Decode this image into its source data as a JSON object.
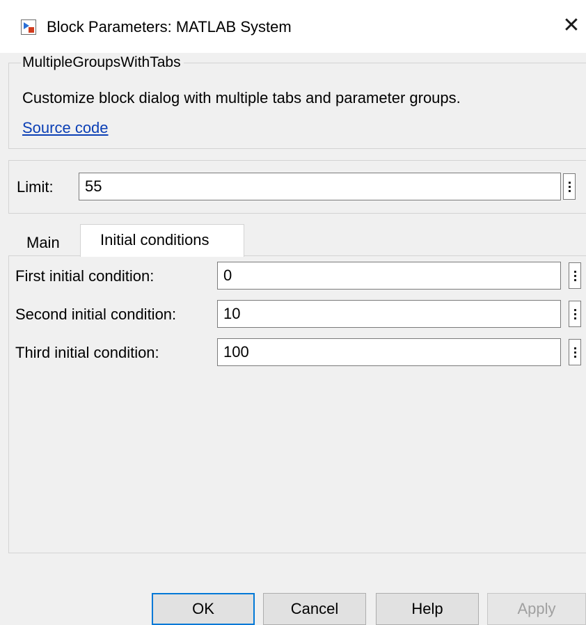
{
  "window": {
    "title": "Block Parameters: MATLAB System",
    "icon": "simulink-block-icon",
    "close_icon": "close-icon"
  },
  "description": {
    "group_title": "MultipleGroupsWithTabs",
    "text": "Customize block dialog with multiple tabs and parameter groups.",
    "link": "Source code"
  },
  "limit": {
    "label": "Limit:",
    "value": "55"
  },
  "tabs": [
    {
      "label": "Main",
      "selected": false
    },
    {
      "label": "Initial conditions",
      "selected": true
    }
  ],
  "initial_conditions": [
    {
      "label": "First initial condition:",
      "value": "0"
    },
    {
      "label": "Second initial condition:",
      "value": "10"
    },
    {
      "label": "Third initial condition:",
      "value": "100"
    }
  ],
  "buttons": {
    "ok": "OK",
    "cancel": "Cancel",
    "help": "Help",
    "apply": "Apply"
  },
  "colors": {
    "link": "#0b3fb5",
    "default_button_border": "#0078d7",
    "disabled_text": "#a0a0a0"
  }
}
